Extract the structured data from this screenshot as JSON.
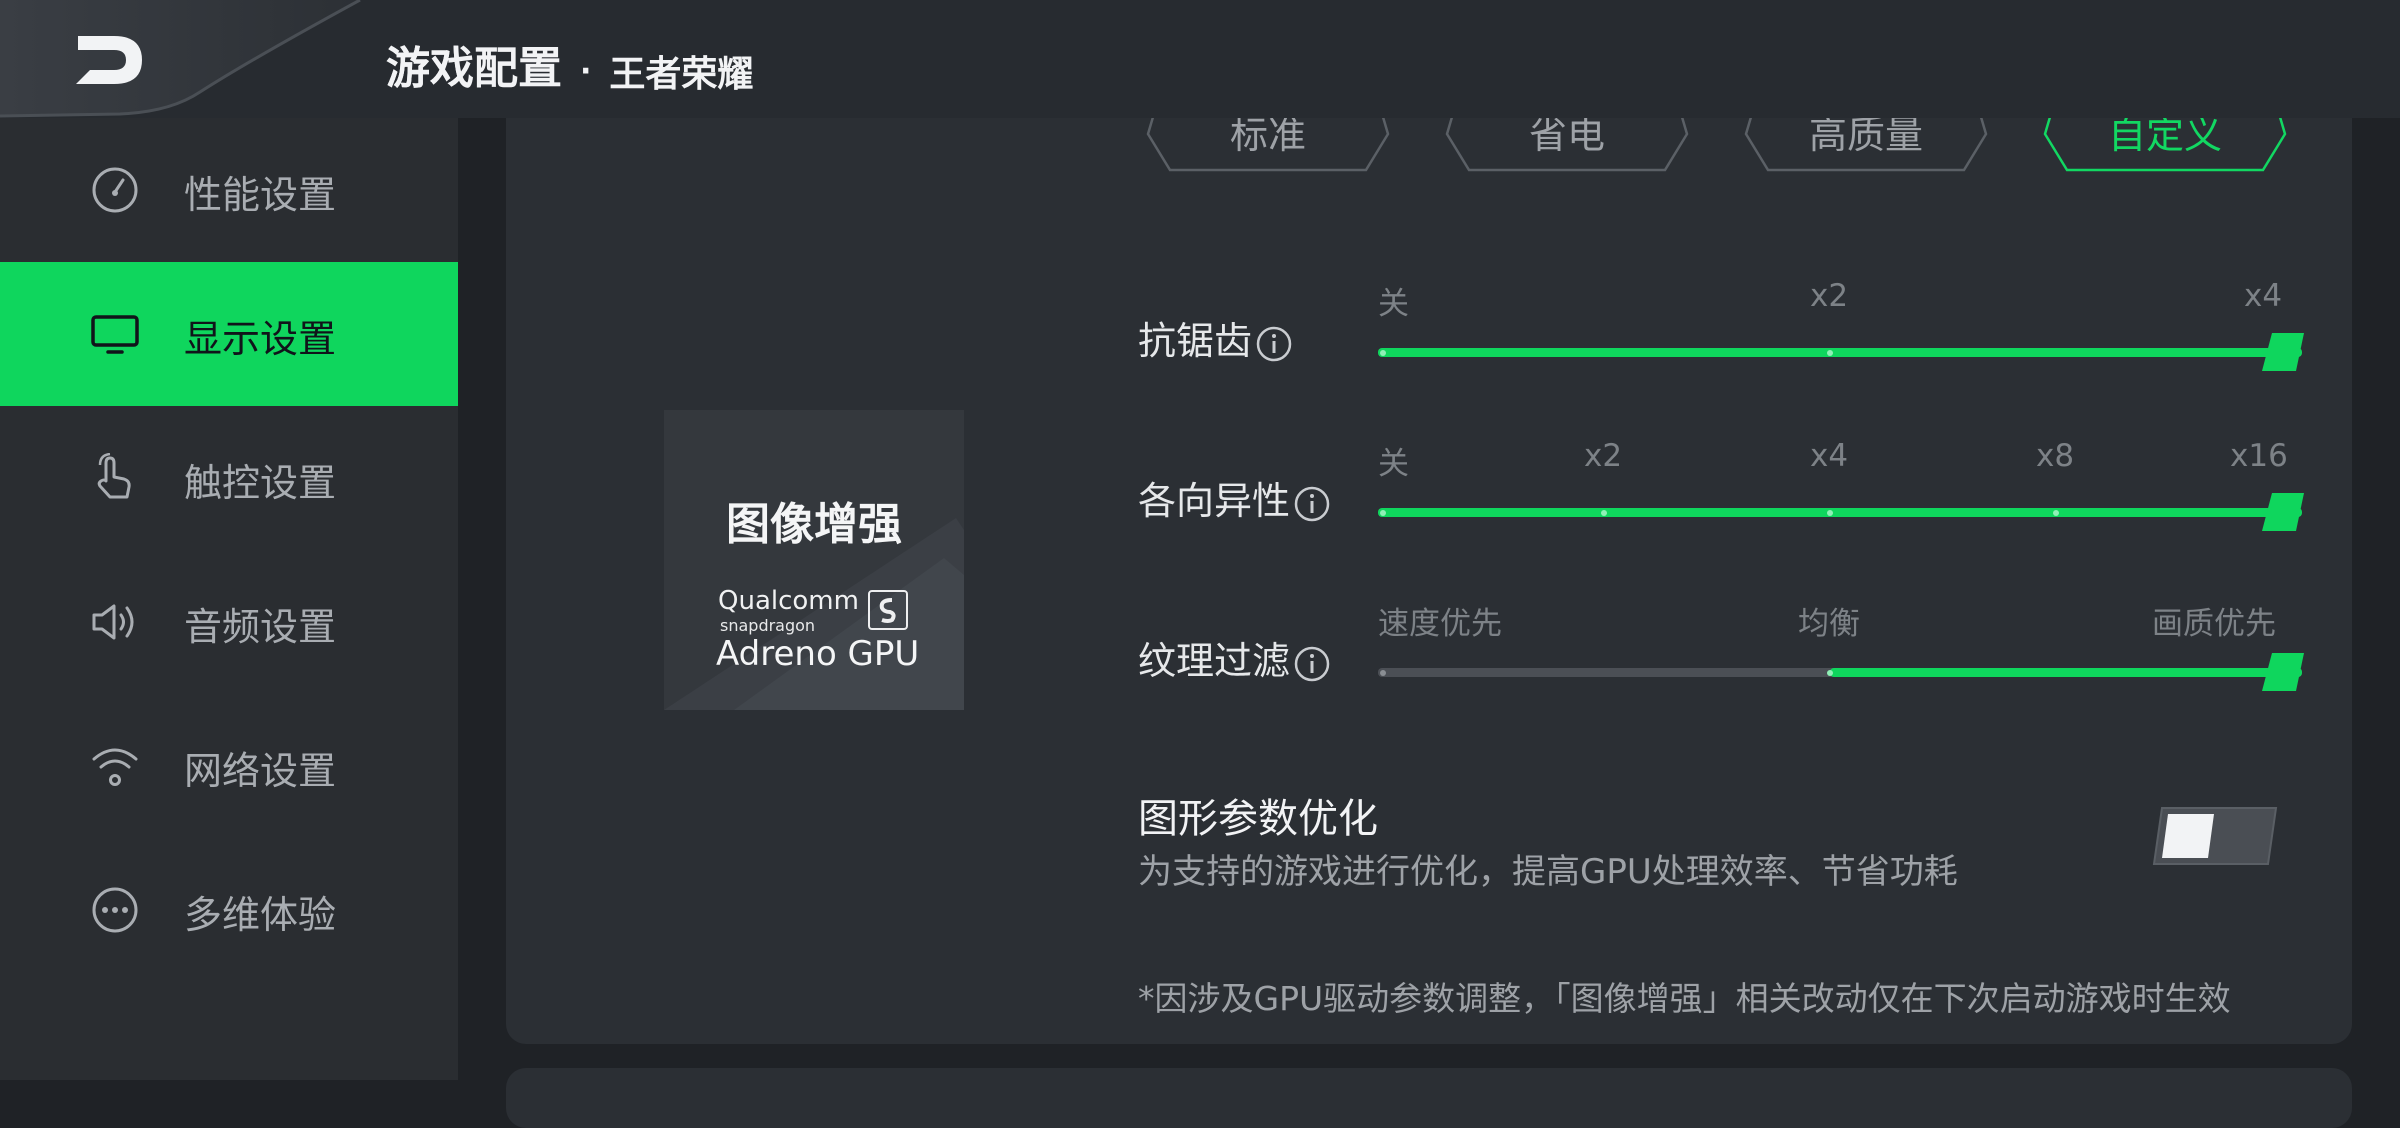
{
  "header": {
    "title": "游戏配置",
    "separator": "·",
    "game_name": "王者荣耀"
  },
  "sidebar": {
    "items": [
      {
        "label": "性能设置",
        "icon": "gauge-icon",
        "active": false
      },
      {
        "label": "显示设置",
        "icon": "monitor-icon",
        "active": true
      },
      {
        "label": "触控设置",
        "icon": "touch-hand-icon",
        "active": false
      },
      {
        "label": "音频设置",
        "icon": "speaker-icon",
        "active": false
      },
      {
        "label": "网络设置",
        "icon": "wifi-icon",
        "active": false
      },
      {
        "label": "多维体验",
        "icon": "more-dots-icon",
        "active": false
      }
    ]
  },
  "presets": [
    {
      "label": "标准",
      "active": false
    },
    {
      "label": "省电",
      "active": false
    },
    {
      "label": "高质量",
      "active": false
    },
    {
      "label": "自定义",
      "active": true
    }
  ],
  "enhance": {
    "title": "图像增强",
    "brand_line1": "Qualcomm",
    "brand_line2": "snapdragon",
    "brand_line3": "Adreno GPU"
  },
  "sliders": [
    {
      "label": "抗锯齿",
      "ticks": [
        "关",
        "x2",
        "x4"
      ],
      "selected_index": 2
    },
    {
      "label": "各向异性",
      "ticks": [
        "关",
        "x2",
        "x4",
        "x8",
        "x16"
      ],
      "selected_index": 4
    },
    {
      "label": "纹理过滤",
      "ticks": [
        "速度优先",
        "均衡",
        "画质优先"
      ],
      "selected_index": 2,
      "fill_from_index": 1
    }
  ],
  "graphics_opt": {
    "title": "图形参数优化",
    "description": "为支持的游戏进行优化，提高GPU处理效率、节省功耗",
    "enabled": false
  },
  "footnote": "*因涉及GPU驱动参数调整，「图像增强」相关改动仅在下次启动游戏时生效",
  "colors": {
    "accent": "#0fd65d",
    "background": "#1f2226",
    "panel": "#2b2f34"
  }
}
